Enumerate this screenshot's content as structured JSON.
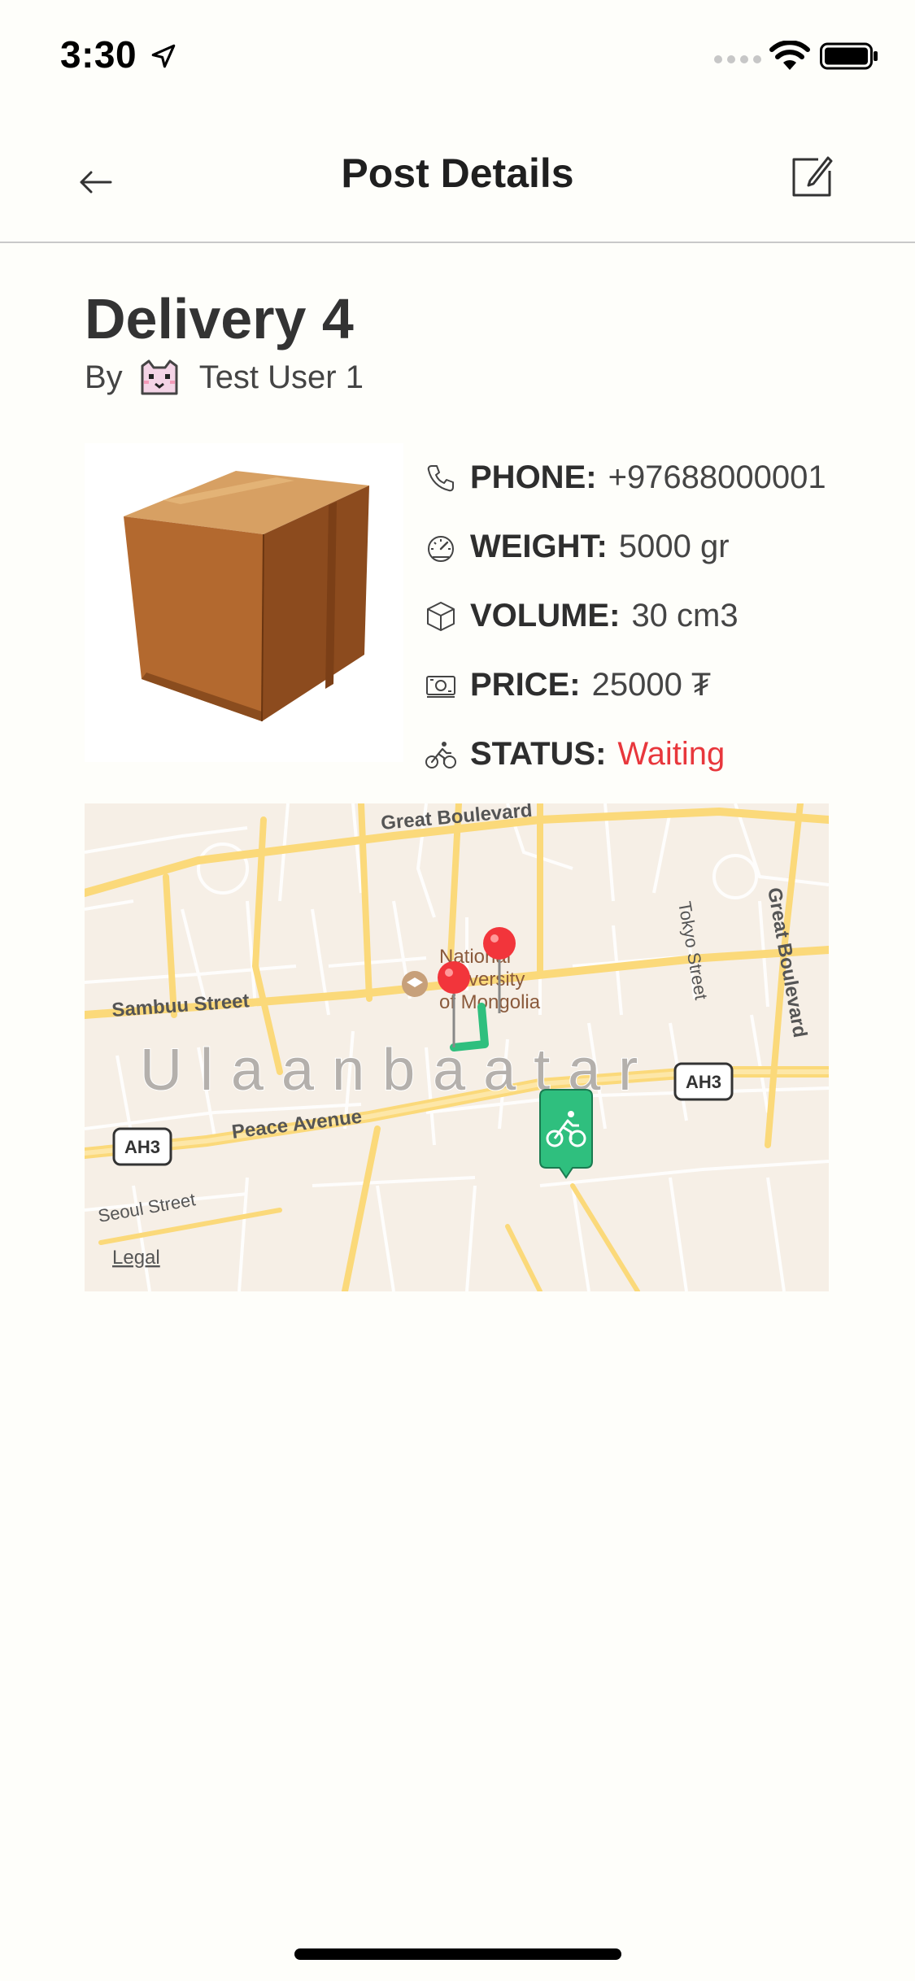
{
  "status_bar": {
    "time": "3:30"
  },
  "nav": {
    "title": "Post Details"
  },
  "post": {
    "title": "Delivery 4",
    "by_label": "By",
    "author": "Test User 1"
  },
  "details": [
    {
      "icon": "phone-icon",
      "label": "PHONE:",
      "value": "+97688000001"
    },
    {
      "icon": "speedometer-icon",
      "label": "WEIGHT:",
      "value": "5000 gr"
    },
    {
      "icon": "cube-icon",
      "label": "VOLUME:",
      "value": "30 cm3"
    },
    {
      "icon": "cash-icon",
      "label": "PRICE:",
      "value": "25000 ₮"
    },
    {
      "icon": "bicycle-icon",
      "label": "STATUS:",
      "value": "Waiting"
    }
  ],
  "map": {
    "city_label": "Ulaanbaatar",
    "streets": {
      "great_boulevard_top": "Great Boulevard",
      "great_boulevard_right": "Great Boulevard",
      "sambuu": "Sambuu Street",
      "peace_avenue": "Peace Avenue",
      "seoul": "Seoul Street",
      "tokyo": "Tokyo Street"
    },
    "poi": "National University of Mongolia",
    "poi_line1": "National",
    "poi_line2": "University",
    "poi_line3": "of Mongolia",
    "highway_shield": "AH3",
    "legal": "Legal"
  },
  "colors": {
    "status_waiting": "#e8373c",
    "rider_marker": "#2fbf7e",
    "pin": "#f2353b"
  }
}
